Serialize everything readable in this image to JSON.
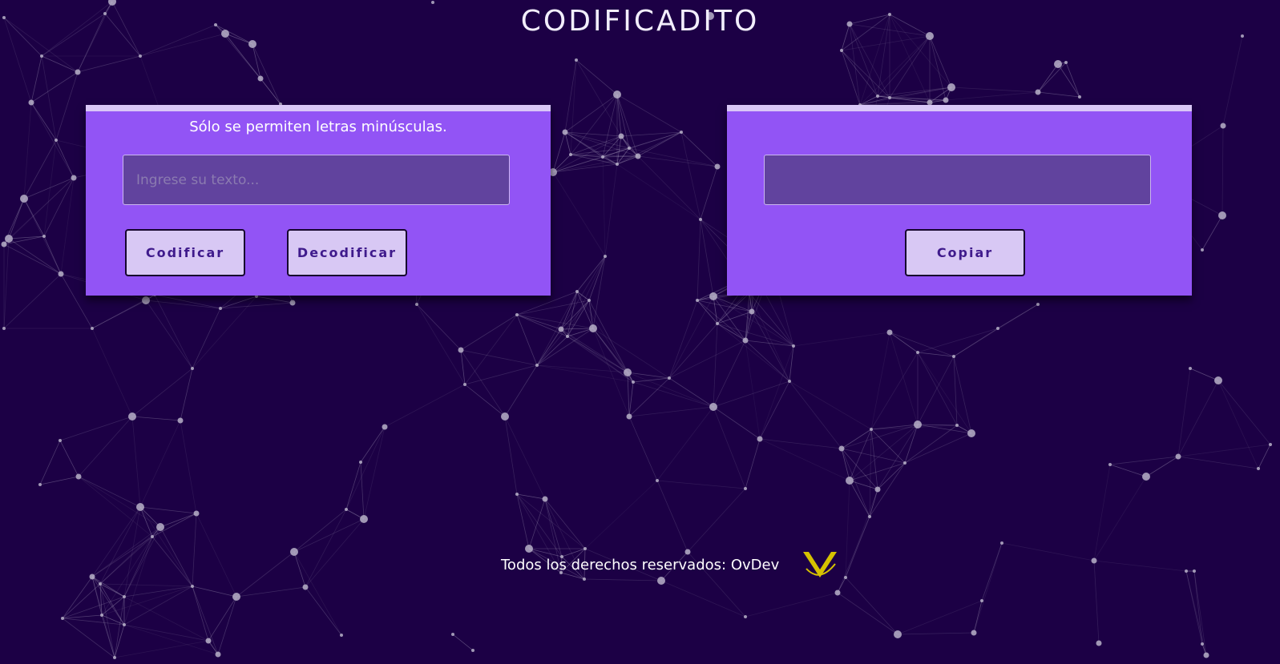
{
  "header": {
    "title": "CODIFICADITO"
  },
  "encoder": {
    "hint": "Sólo se permiten letras minúsculas.",
    "input_placeholder": "Ingrese su texto...",
    "input_value": "",
    "encode_label": "Codificar",
    "decode_label": "Decodificar"
  },
  "output": {
    "value": "",
    "copy_label": "Copiar"
  },
  "footer": {
    "text": "Todos los derechos reservados: OvDev",
    "logo_icon": "ovdev-v-logo-icon",
    "logo_color": "#d6c200"
  },
  "theme": {
    "background": "#1c0045",
    "panel": "#9254f5",
    "panel_border": "#d9c7f7",
    "field": "#61439e",
    "button": "#d8c8f4",
    "button_text": "#3f1a8c",
    "network": "#b7b0c8"
  }
}
